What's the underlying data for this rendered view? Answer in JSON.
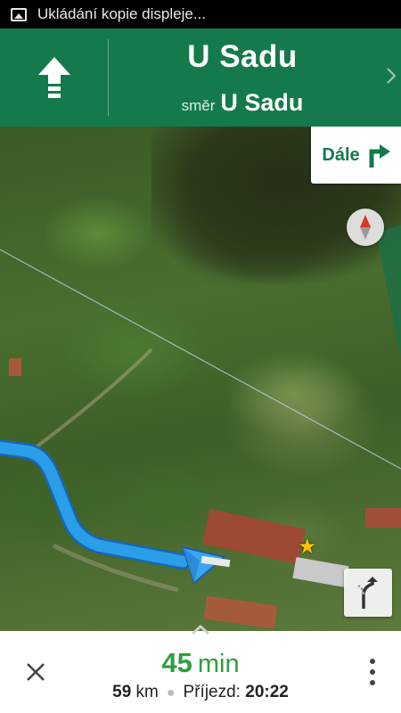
{
  "status_bar": {
    "notification_icon": "image-icon",
    "notification_text": "Ukládání kopie displeje..."
  },
  "navigation": {
    "maneuver_icon": "straight-arrow-icon",
    "street_name": "U Sadu",
    "direction_word": "směr",
    "direction_name": "U Sadu",
    "next_step_icon": "chevron-right-icon",
    "accent_color": "#147a4c"
  },
  "map": {
    "next_turn_label": "Dále",
    "next_turn_icon": "turn-right-icon",
    "compass_icon": "compass-icon",
    "favorite_icon": "star-icon",
    "reroute_icon": "alternate-route-icon",
    "route_color": "#2a9fe8"
  },
  "trip": {
    "eta_minutes": "45",
    "eta_unit": "min",
    "distance_value": "59",
    "distance_unit": "km",
    "arrival_label": "Příjezd:",
    "arrival_time": "20:22",
    "close_icon": "close-icon",
    "menu_icon": "more-vert-icon",
    "expand_icon": "chevron-up-icon",
    "eta_color": "#2e9e3c"
  }
}
